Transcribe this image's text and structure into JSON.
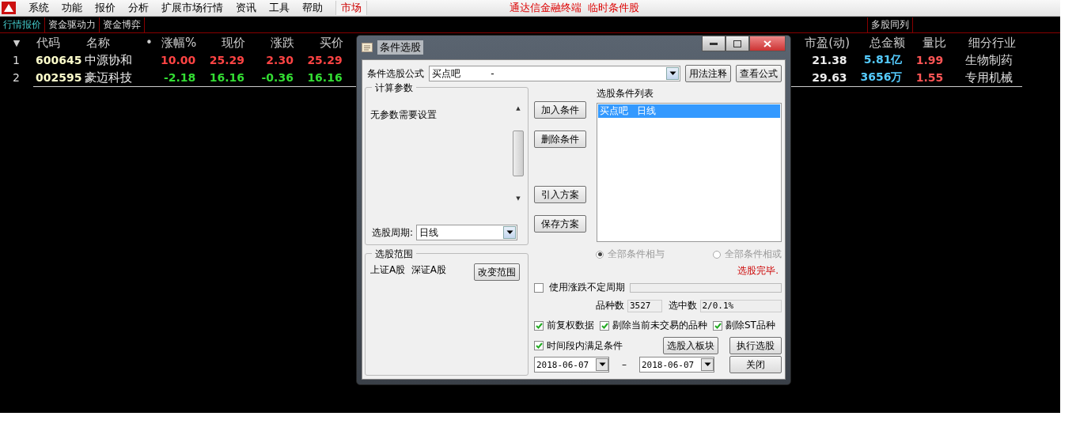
{
  "menu_bar": {
    "items": [
      "系统",
      "功能",
      "报价",
      "分析",
      "扩展市场行情",
      "资讯",
      "工具",
      "帮助"
    ],
    "market_tab": "市场",
    "title": "通达信金融终端  临时条件股"
  },
  "tabs": [
    {
      "label": "行情报价",
      "selected": true
    },
    {
      "label": "资金驱动力",
      "selected": false
    },
    {
      "label": "资金博弈",
      "selected": false
    }
  ],
  "right_tab": "多股同列",
  "table": {
    "sort_marker": "▼",
    "columns_left": [
      "代码",
      "名称",
      "•",
      "涨幅%",
      "现价",
      "涨跌",
      "买价"
    ],
    "columns_right": [
      "市盈(动)",
      "总金额",
      "量比",
      "细分行业"
    ],
    "rows": [
      {
        "index": "1",
        "code": "600645",
        "name": "中源协和",
        "color": "#ff4444",
        "change_pct": "10.00",
        "price": "25.29",
        "change": "2.30",
        "bid": "25.29",
        "pe": "21.38",
        "amount": "5.81亿",
        "volume_ratio": "1.99",
        "industry": "生物制药"
      },
      {
        "index": "2",
        "code": "002595",
        "name": "豪迈科技",
        "color": "#33dd33",
        "change_pct": "-2.18",
        "price": "16.16",
        "change": "-0.36",
        "bid": "16.16",
        "pe": "29.63",
        "amount": "3656万",
        "volume_ratio": "1.55",
        "industry": "专用机械"
      }
    ]
  },
  "dialog": {
    "title": "条件选股",
    "formula_label": "条件选股公式",
    "scroll_up": "▲",
    "scroll_down": "▼",
    "formula_value": "买点吧          -",
    "usage_button": "用法注释",
    "view_button": "查看公式",
    "params_group": "计算参数",
    "params_text": "无参数需要设置",
    "period_label": "选股周期:",
    "period_value": "日线",
    "range_group": "选股范围",
    "range_text": "上证A股  深证A股",
    "change_range_button": "改变范围",
    "side_buttons": [
      "加入条件",
      "删除条件",
      "引入方案",
      "保存方案"
    ],
    "list_label": "选股条件列表",
    "conditions": [
      {
        "label": "买点吧   日线",
        "selected": true
      }
    ],
    "radios": [
      {
        "label": "全部条件相与",
        "selected": true,
        "disabled": true
      },
      {
        "label": "全部条件相或",
        "selected": false,
        "disabled": true
      }
    ],
    "status": "选股完毕.",
    "variable_period": {
      "label": "使用涨跌不定周期",
      "checked": false,
      "level": 0
    },
    "count_label": "品种数",
    "count_value": "3527",
    "selected_label": "选中数",
    "selected_value": "2/0.1%",
    "options": [
      {
        "label": "前复权数据",
        "checked": true
      },
      {
        "label": "剔除当前未交易的品种",
        "checked": true
      },
      {
        "label": "剔除ST品种",
        "checked": true
      }
    ],
    "time_option": {
      "label": "时间段内满足条件",
      "checked": true
    },
    "to_block_button": "选股入板块",
    "run_button": "执行选股",
    "date_from": "2018-06-07",
    "date_sep": "–",
    "date_to": "2018-06-07",
    "close_button": "关闭"
  }
}
